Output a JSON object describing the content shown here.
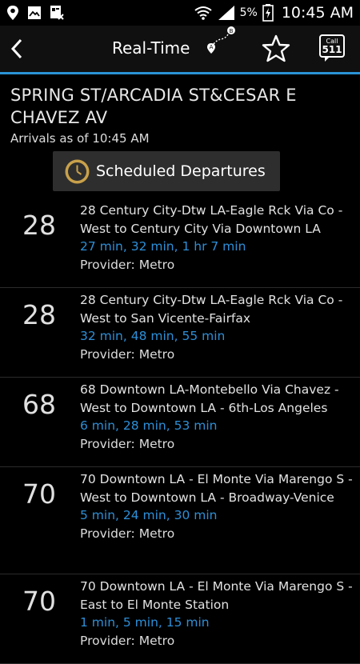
{
  "status_bar": {
    "time": "10:45 AM",
    "battery_percent": "5%",
    "icons": [
      "location-icon",
      "gallery-icon",
      "app-notification-icon",
      "wifi-icon",
      "signal-icon",
      "battery-charging-icon"
    ]
  },
  "header": {
    "title": "Real-Time",
    "call_badge_text": "Call",
    "call_badge_number": "511",
    "accent_color": "#2a93d5"
  },
  "stop": {
    "name": "SPRING ST/ARCADIA ST&CESAR E CHAVEZ AV",
    "arrivals_as_of": "Arrivals as of 10:45 AM",
    "scheduled_button_label": "Scheduled Departures"
  },
  "routes": [
    {
      "number": "28",
      "description": "28 Century City-Dtw LA-Eagle Rck Via Co - West to Century City Via Downtown LA",
      "times": "27 min, 32 min, 1 hr 7 min",
      "provider": "Provider: Metro"
    },
    {
      "number": "28",
      "description": "28 Century City-Dtw LA-Eagle Rck Via Co - West to San Vicente-Fairfax",
      "times": "32 min, 48 min, 55 min",
      "provider": "Provider: Metro"
    },
    {
      "number": "68",
      "description": "68 Downtown LA-Montebello Via Chavez - West to Downtown LA - 6th-Los Angeles",
      "times": "6 min, 28 min, 53 min",
      "provider": "Provider: Metro"
    },
    {
      "number": "70",
      "description": "70 Downtown LA - El Monte Via Marengo S - West to Downtown LA - Broadway-Venice",
      "times": "5 min, 24 min, 30 min",
      "provider": "Provider: Metro"
    },
    {
      "number": "70",
      "description": "70 Downtown LA - El Monte Via Marengo S - East to El Monte Station",
      "times": "1 min, 5 min, 15 min",
      "provider": "Provider: Metro"
    }
  ]
}
